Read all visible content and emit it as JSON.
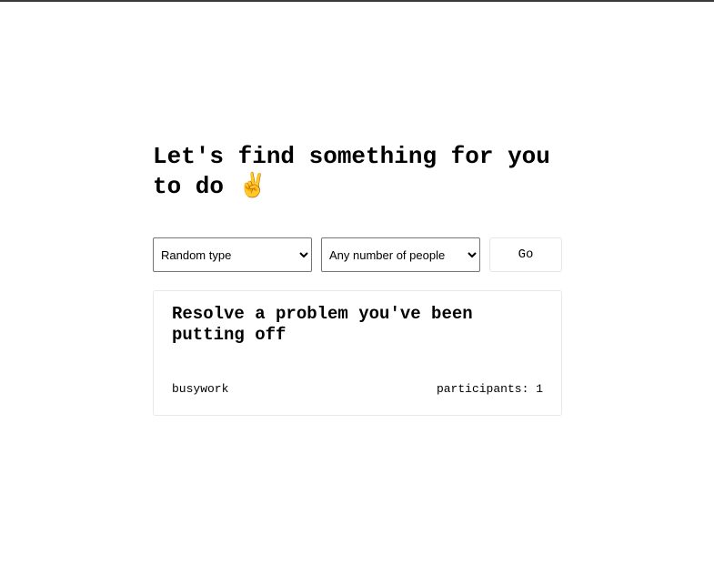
{
  "header": {
    "title": "Let's find something for you to do",
    "title_emoji": "✌️"
  },
  "filters": {
    "type_select": {
      "selected": "Random type",
      "options": [
        "Random type"
      ]
    },
    "people_select": {
      "selected": "Any number of people",
      "options": [
        "Any number of people"
      ]
    },
    "go_label": "Go"
  },
  "activity": {
    "title": "Resolve a problem you've been putting off",
    "type": "busywork",
    "participants_label": "participants:",
    "participants_value": "1"
  },
  "icons": {
    "title_emoji": "victory-hand-icon"
  }
}
